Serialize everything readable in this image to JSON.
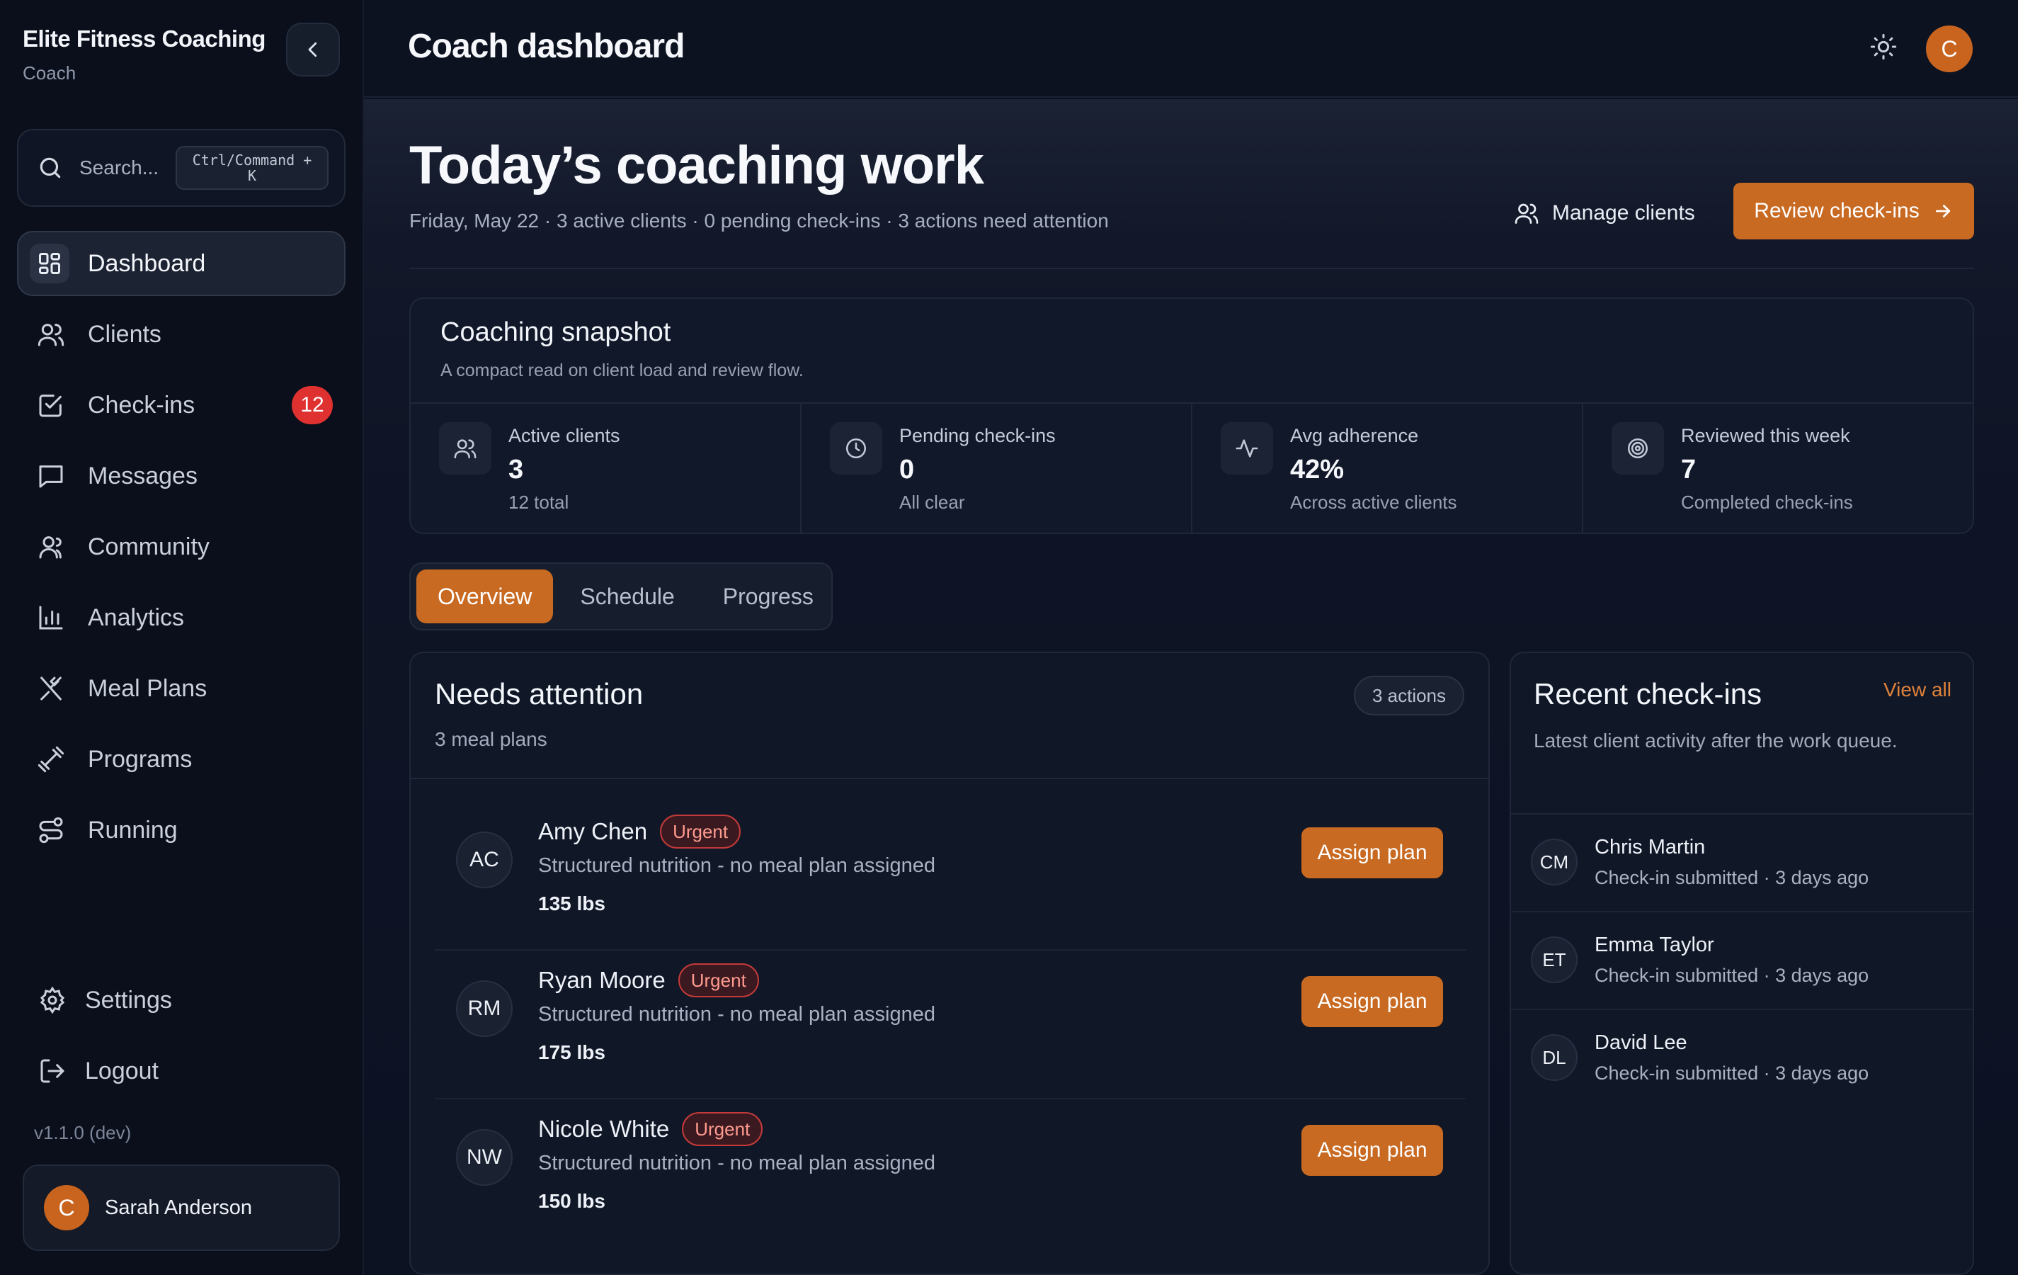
{
  "sidebar": {
    "brand_name": "Elite Fitness Coaching",
    "brand_role": "Coach",
    "search_placeholder": "Search...",
    "search_shortcut_line1": "Ctrl/Command +",
    "search_shortcut_line2": "K",
    "items": [
      {
        "label": "Dashboard",
        "icon": "dashboard-icon",
        "active": true
      },
      {
        "label": "Clients",
        "icon": "users-icon"
      },
      {
        "label": "Check-ins",
        "icon": "checkbox-icon",
        "badge": "12"
      },
      {
        "label": "Messages",
        "icon": "message-icon"
      },
      {
        "label": "Community",
        "icon": "community-icon"
      },
      {
        "label": "Analytics",
        "icon": "bar-chart-icon"
      },
      {
        "label": "Meal Plans",
        "icon": "utensils-icon"
      },
      {
        "label": "Programs",
        "icon": "dumbbell-icon"
      },
      {
        "label": "Running",
        "icon": "route-icon"
      }
    ],
    "settings_label": "Settings",
    "logout_label": "Logout",
    "version": "v1.1.0 (dev)",
    "user": {
      "initial": "C",
      "name": "Sarah Anderson"
    }
  },
  "topbar": {
    "title": "Coach dashboard",
    "avatar_initial": "C"
  },
  "hero": {
    "title": "Today’s coaching work",
    "subtitle": "Friday, May 22 · 3 active clients · 0 pending check-ins · 3 actions need attention",
    "manage_label": "Manage clients",
    "review_label": "Review check-ins"
  },
  "snapshot": {
    "title": "Coaching snapshot",
    "subtitle": "A compact read on client load and review flow.",
    "stats": [
      {
        "label": "Active clients",
        "value": "3",
        "sub": "12 total",
        "icon": "users-icon"
      },
      {
        "label": "Pending check-ins",
        "value": "0",
        "sub": "All clear",
        "icon": "clock-icon"
      },
      {
        "label": "Avg adherence",
        "value": "42%",
        "sub": "Across active clients",
        "icon": "activity-icon"
      },
      {
        "label": "Reviewed this week",
        "value": "7",
        "sub": "Completed check-ins",
        "icon": "target-icon"
      }
    ]
  },
  "tabs": [
    "Overview",
    "Schedule",
    "Progress"
  ],
  "attention": {
    "title": "Needs attention",
    "subtitle": "3 meal plans",
    "count_pill": "3 actions",
    "urgent_label": "Urgent",
    "assign_label": "Assign plan",
    "rows": [
      {
        "initials": "AC",
        "name": "Amy Chen",
        "desc": "Structured nutrition - no meal plan assigned",
        "weight": "135 lbs"
      },
      {
        "initials": "RM",
        "name": "Ryan Moore",
        "desc": "Structured nutrition - no meal plan assigned",
        "weight": "175 lbs"
      },
      {
        "initials": "NW",
        "name": "Nicole White",
        "desc": "Structured nutrition - no meal plan assigned",
        "weight": "150 lbs"
      }
    ]
  },
  "recent": {
    "title": "Recent check-ins",
    "view_all": "View all",
    "subtitle": "Latest client activity after the work queue.",
    "rows": [
      {
        "initials": "CM",
        "name": "Chris Martin",
        "meta": "Check-in submitted · 3 days ago"
      },
      {
        "initials": "ET",
        "name": "Emma Taylor",
        "meta": "Check-in submitted · 3 days ago"
      },
      {
        "initials": "DL",
        "name": "David Lee",
        "meta": "Check-in submitted · 3 days ago"
      }
    ]
  },
  "colors": {
    "accent": "#c86a22",
    "badge_red": "#e03131",
    "background": "#0b1020"
  }
}
